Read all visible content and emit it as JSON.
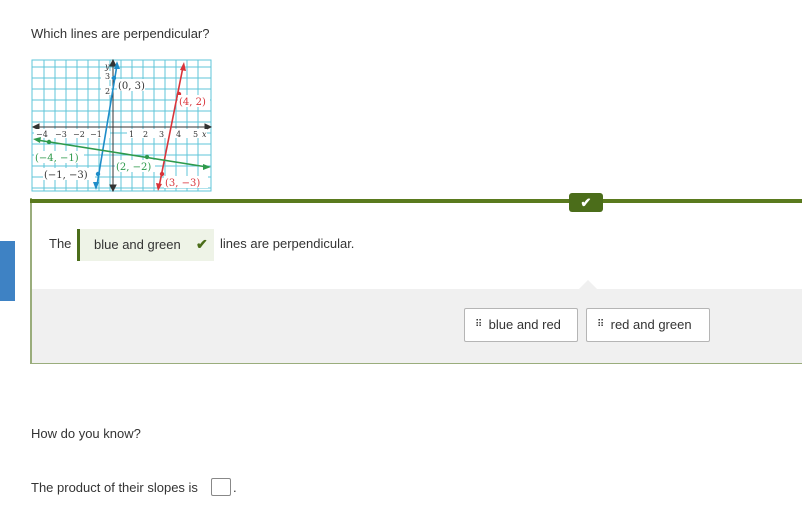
{
  "question": "Which lines are perpendicular?",
  "graph": {
    "x_ticks": [
      "−4",
      "−3",
      "−2",
      "−1",
      "1",
      "2",
      "3",
      "4",
      "5"
    ],
    "y_ticks": [
      "3",
      "2"
    ],
    "x_axis_label": "x",
    "y_axis_label": "y",
    "points": {
      "blue_top": "(0, 3)",
      "blue_bottom": "(−1, −3)",
      "red_top": "(4, 2)",
      "red_bottom": "(3, −3)",
      "green_left": "(−4, −1)",
      "green_right": "(2, −2)"
    },
    "colors": {
      "blue": "#1f8dc9",
      "red": "#d9343a",
      "green": "#2e9a4c",
      "grid": "#5fc6d9"
    }
  },
  "answer": {
    "prefix": "The",
    "selected": "blue and green",
    "suffix": "lines are perpendicular.",
    "check_icon": "✔"
  },
  "choices": [
    {
      "label": "blue and red"
    },
    {
      "label": "red and green"
    }
  ],
  "followup": {
    "question": "How do you know?",
    "product_text": "The product of their slopes is",
    "period": "."
  },
  "colors": {
    "correct_green": "#4b6d1a",
    "tray_bg": "#f0f0f0",
    "side_tab": "#3e82c4"
  }
}
